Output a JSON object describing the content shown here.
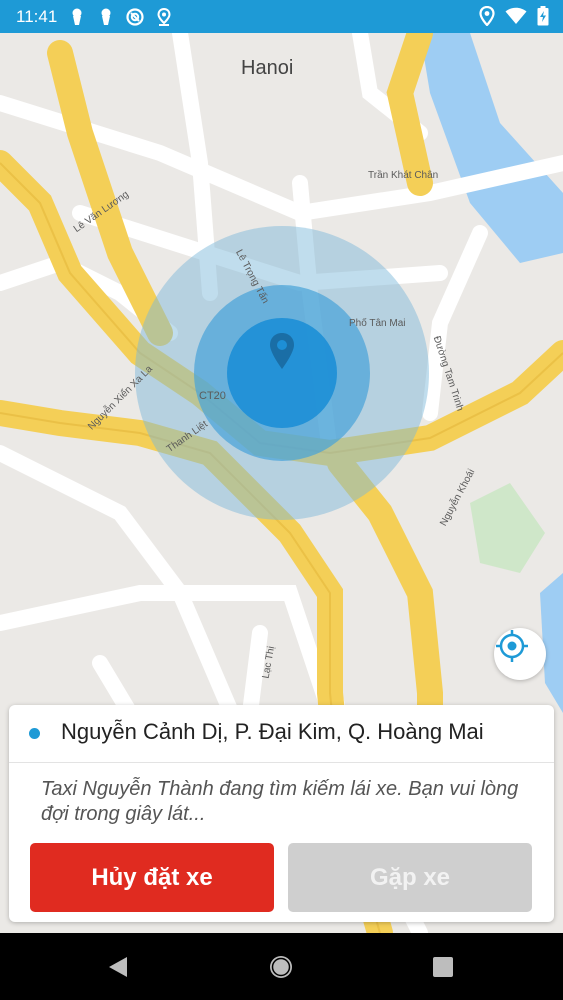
{
  "status_bar": {
    "time": "11:41",
    "left_icons": [
      "keyhole-icon",
      "keyhole-icon",
      "vpn-icon",
      "location-icon"
    ],
    "right_icons": [
      "location-icon",
      "wifi-icon",
      "battery-charging-icon"
    ]
  },
  "map": {
    "city": "Hanoi",
    "labels": [
      "Trần Khát Chân",
      "Lê Văn Lương",
      "Lê Trọng Tấn",
      "Phố Tân Mai",
      "Đường Tam Trinh",
      "Nguyễn Xiển Xa La",
      "CT20",
      "Thanh Liệt",
      "Nguyễn Khoái",
      "Lạc Thị"
    ]
  },
  "panel": {
    "address": "Nguyễn Cảnh Dị, P. Đại Kim, Q. Hoàng Mai",
    "message": "Taxi Nguyễn Thành đang tìm kiếm lái xe. Bạn vui lòng đợi trong giây lát...",
    "cancel_label": "Hủy đặt xe",
    "meet_label": "Gặp xe"
  },
  "colors": {
    "accent": "#1e9ad6",
    "cancel": "#e02b20",
    "disabled": "#cfcfcf"
  }
}
